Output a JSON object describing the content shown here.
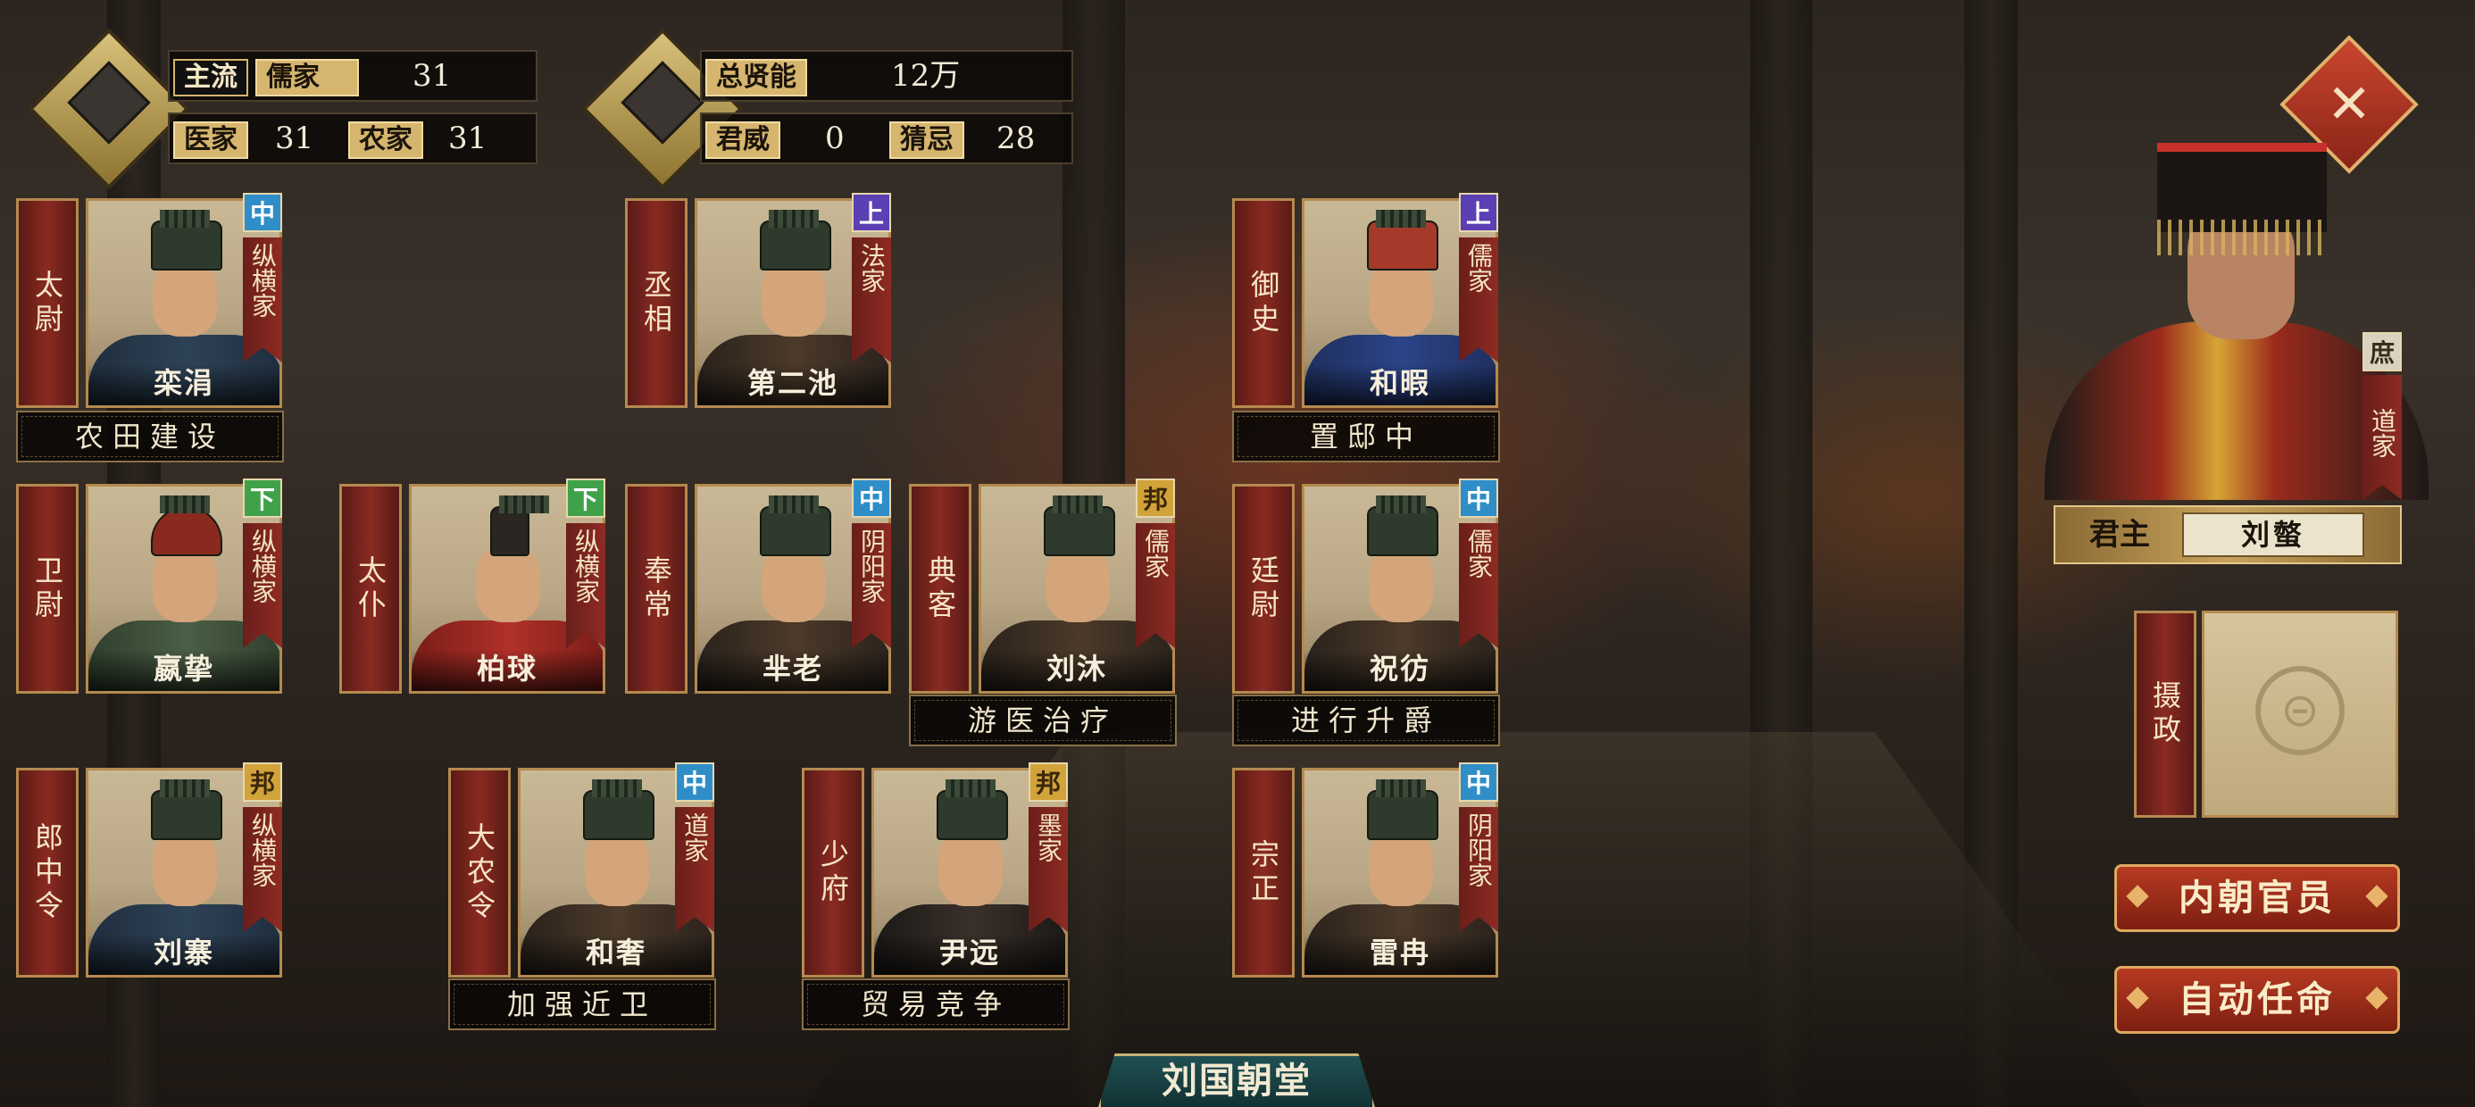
{
  "stats": {
    "mainstream_label": "主流",
    "mainstream_school": "儒家",
    "mainstream_value": "31",
    "school2_label": "医家",
    "school2_value": "31",
    "school3_label": "农家",
    "school3_value": "31",
    "total_talent_label": "总贤能",
    "total_talent_value": "12万",
    "prestige_label": "君威",
    "prestige_value": "0",
    "suspicion_label": "猜忌",
    "suspicion_value": "28"
  },
  "ministers": [
    {
      "title": "太尉",
      "name": "栾涓",
      "school": "纵横家",
      "grade": "中",
      "policy": "农田建设"
    },
    {
      "title": "丞相",
      "name": "第二池",
      "school": "法家",
      "grade": "上",
      "policy": ""
    },
    {
      "title": "御史",
      "name": "和暇",
      "school": "儒家",
      "grade": "上",
      "policy": "置邸中"
    },
    {
      "title": "卫尉",
      "name": "嬴挚",
      "school": "纵横家",
      "grade": "下",
      "policy": ""
    },
    {
      "title": "太仆",
      "name": "柏球",
      "school": "纵横家",
      "grade": "下",
      "policy": ""
    },
    {
      "title": "奉常",
      "name": "芈老",
      "school": "阴阳家",
      "grade": "中",
      "policy": ""
    },
    {
      "title": "典客",
      "name": "刘沐",
      "school": "儒家",
      "grade": "邦",
      "policy": "游医治疗"
    },
    {
      "title": "廷尉",
      "name": "祝彷",
      "school": "儒家",
      "grade": "中",
      "policy": "进行升爵"
    },
    {
      "title": "郎中令",
      "name": "刘寨",
      "school": "纵横家",
      "grade": "邦",
      "policy": ""
    },
    {
      "title": "大农令",
      "name": "和奢",
      "school": "道家",
      "grade": "中",
      "policy": "加强近卫"
    },
    {
      "title": "少府",
      "name": "尹远",
      "school": "墨家",
      "grade": "邦",
      "policy": "贸易竞争"
    },
    {
      "title": "宗正",
      "name": "雷冉",
      "school": "阴阳家",
      "grade": "中",
      "policy": ""
    }
  ],
  "lord": {
    "title": "君主",
    "name": "刘螫",
    "grade": "庶",
    "school": "道家"
  },
  "regent": {
    "label": "摄政"
  },
  "buttons": {
    "inner_court": "内朝官员",
    "auto_appoint": "自动任命",
    "close": "✕"
  },
  "court_tab": "刘国朝堂",
  "colors": {
    "grade_mid": "#2f8ec8",
    "grade_high": "#5b3fb4",
    "grade_low": "#3fa24a",
    "grade_bang": "#d2a33a",
    "banner_red": "#8a2a22",
    "gold": "#d6b56e"
  },
  "icons": [
    "bamboo-scroll-icon",
    "bronze-vessel-icon",
    "close-icon",
    "regent-seal-icon"
  ]
}
